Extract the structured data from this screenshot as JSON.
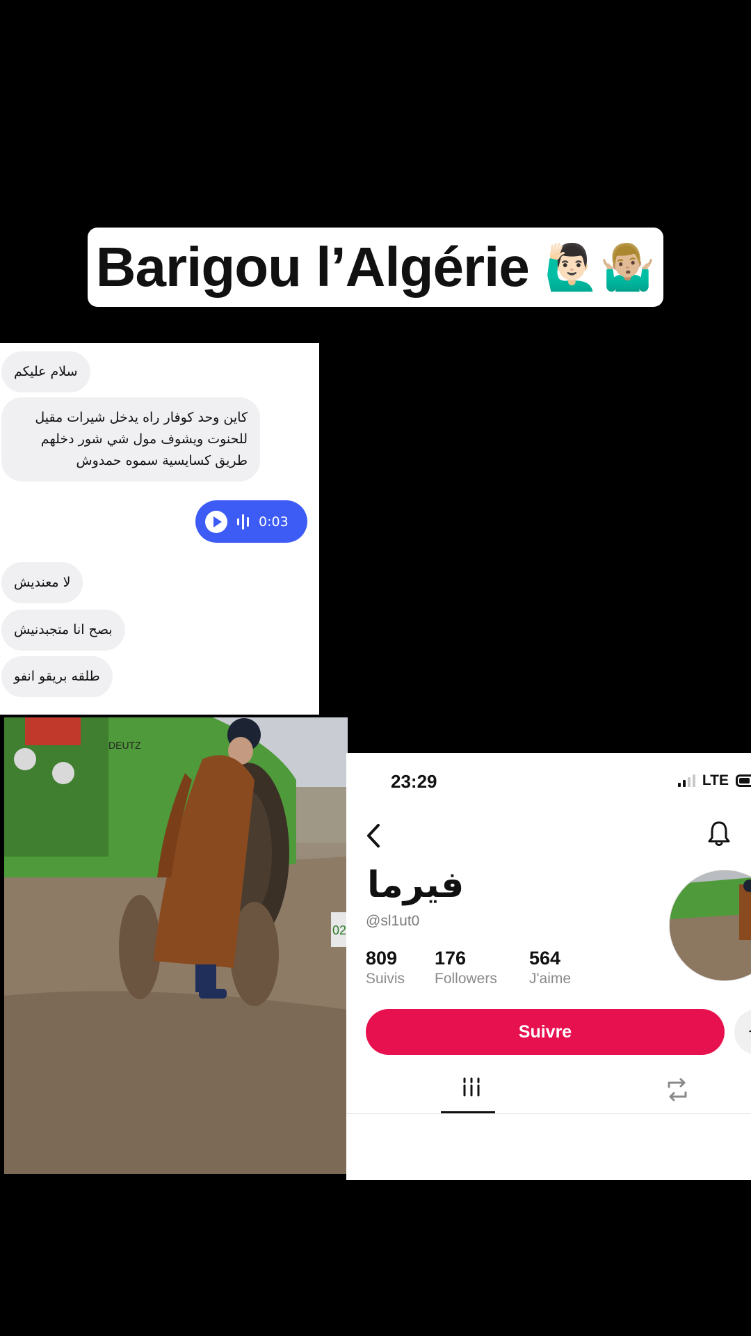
{
  "title": {
    "text": "Barigou l’Algérie",
    "emoji": "🙋🏻‍♂️🤷🏼‍♂️"
  },
  "chat": {
    "messages": [
      {
        "text": "سلام عليكم"
      },
      {
        "text": "كاين وحد كوفار راه يدخل شيرات مقيل للحنوت ويشوف مول شي شور دخلهم طريق كسايسية سموه حمدوش"
      },
      {
        "text": "لا معنديش"
      },
      {
        "text": "بصح انا متجبدنيش"
      },
      {
        "text": "طلقه بريقو انفو"
      }
    ],
    "voice": {
      "duration": "0:03",
      "color": "#3d5cf5"
    }
  },
  "photo": {
    "tractor_label": "DEUTZ",
    "plate": "02"
  },
  "profile": {
    "status_time": "23:29",
    "network": "LTE",
    "name": "فيرما",
    "handle": "@sl1ut0",
    "stats": [
      {
        "value": "809",
        "label": "Suivis"
      },
      {
        "value": "176",
        "label": "Followers"
      },
      {
        "value": "564",
        "label": "J'aime"
      }
    ],
    "follow_label": "Suivre",
    "more_label": "+",
    "accent": "#e8114f"
  }
}
